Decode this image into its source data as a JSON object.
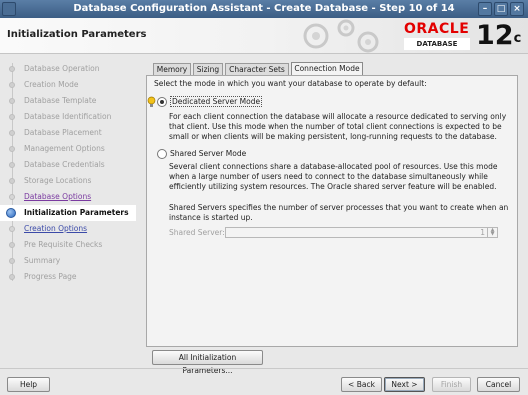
{
  "window": {
    "title": "Database Configuration Assistant - Create Database - Step 10 of 14"
  },
  "header": {
    "heading": "Initialization Parameters",
    "brand": "ORACLE",
    "brand_sub": "DATABASE",
    "version": "12",
    "version_sup": "c"
  },
  "steps": [
    {
      "label": "Database Operation",
      "state": "disabled"
    },
    {
      "label": "Creation Mode",
      "state": "disabled"
    },
    {
      "label": "Database Template",
      "state": "disabled"
    },
    {
      "label": "Database Identification",
      "state": "disabled"
    },
    {
      "label": "Database Placement",
      "state": "disabled"
    },
    {
      "label": "Management Options",
      "state": "disabled"
    },
    {
      "label": "Database Credentials",
      "state": "disabled"
    },
    {
      "label": "Storage Locations",
      "state": "disabled"
    },
    {
      "label": "Database Options",
      "state": "visited"
    },
    {
      "label": "Initialization Parameters",
      "state": "current"
    },
    {
      "label": "Creation Options",
      "state": "link"
    },
    {
      "label": "Pre Requisite Checks",
      "state": "disabled"
    },
    {
      "label": "Summary",
      "state": "disabled"
    },
    {
      "label": "Progress Page",
      "state": "disabled"
    }
  ],
  "tabs": [
    {
      "label": "Memory"
    },
    {
      "label": "Sizing"
    },
    {
      "label": "Character Sets"
    },
    {
      "label": "Connection Mode",
      "active": true
    }
  ],
  "connection_mode": {
    "intro": "Select the mode in which you want your database to operate by default:",
    "dedicated_label": "Dedicated Server Mode",
    "dedicated_desc": "For each client connection the database will allocate a resource dedicated to serving only that client.  Use this mode when the number of total client connections is expected to be small or when clients will be making persistent, long-running requests to the database.",
    "shared_label": "Shared Server Mode",
    "shared_desc": "Several client connections share a database-allocated pool of resources.  Use this mode when a large number of users need to connect to the database simultaneously while efficiently utilizing system resources.  The Oracle shared server feature will be enabled.",
    "shared_servers_desc": "Shared Servers specifies the number of server processes that you want to create when an instance is started up.",
    "shared_server_label": "Shared Server:",
    "shared_server_value": "1",
    "selected": "dedicated"
  },
  "buttons": {
    "all_params": "All Initialization Parameters...",
    "help": "Help",
    "back": "< Back",
    "next": "Next >",
    "finish": "Finish",
    "cancel": "Cancel"
  }
}
